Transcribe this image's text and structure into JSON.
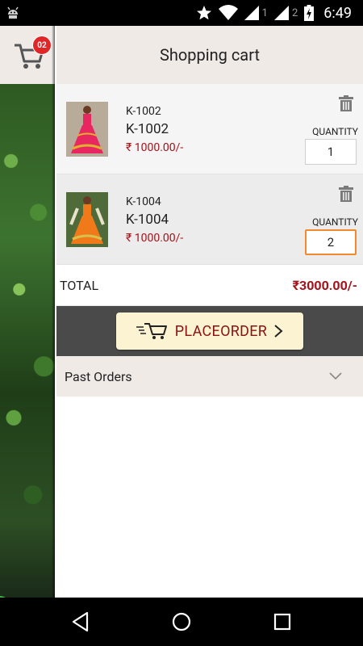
{
  "status_bar": {
    "sim1": "1",
    "sim2": "2",
    "time": "6:49"
  },
  "side": {
    "cart_badge": "02"
  },
  "header": {
    "title": "Shopping cart"
  },
  "cart_items": [
    {
      "code_small": "K-1002",
      "code_big": "K-1002",
      "price": "1000.00/-",
      "quantity_label": "QUANTITY",
      "quantity": "1",
      "thumb_color": "#e8265f"
    },
    {
      "code_small": "K-1004",
      "code_big": "K-1004",
      "price": "1000.00/-",
      "quantity_label": "QUANTITY",
      "quantity": "2",
      "thumb_color": "#f07a1a"
    }
  ],
  "currency_symbol": "₹",
  "total": {
    "label": "TOTAL",
    "value": "3000.00/-"
  },
  "place_order": {
    "label": "PLACEORDER"
  },
  "past_orders": {
    "label": "Past Orders"
  },
  "colors": {
    "price": "#a5121a",
    "badge": "#e02626",
    "active_border": "#f08a2c",
    "button_bg": "#fbf3d2"
  }
}
